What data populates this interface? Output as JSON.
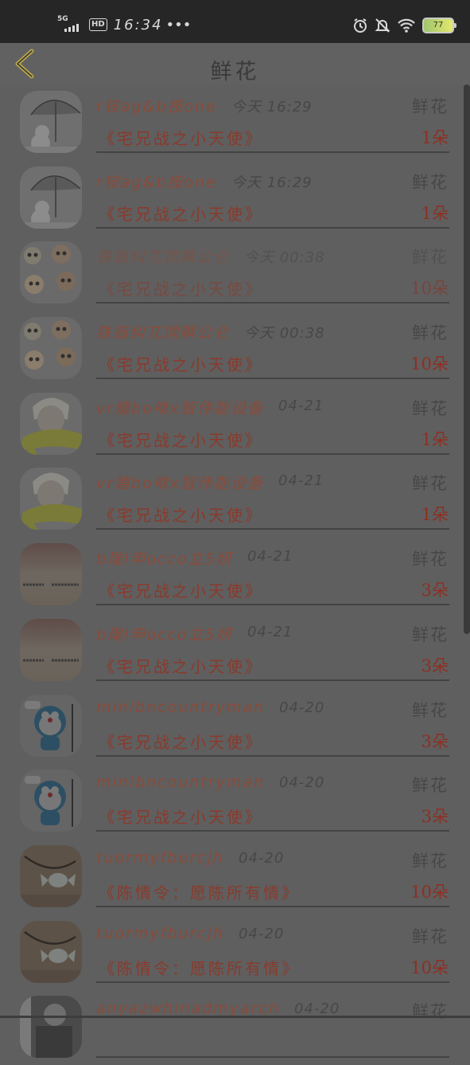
{
  "status_bar": {
    "network": "5G",
    "hd": "HD",
    "time": "16:34",
    "more": "•••",
    "battery": "77"
  },
  "header": {
    "title": "鲜花"
  },
  "items": [
    {
      "name": "r铵ag&b按one",
      "time": "今天 16:29",
      "gift": "鲜花",
      "title": "《宅兄战之小天使》",
      "qty": "1朵",
      "avatar": "umbrella-snowman"
    },
    {
      "name": "r铵ag&b按one",
      "time": "今天 16:29",
      "gift": "鲜花",
      "title": "《宅兄战之小天使》",
      "qty": "1朵",
      "avatar": "umbrella-snowman"
    },
    {
      "name": "铁扇纠兀饲瞬公仑",
      "time": "今天 00:38",
      "gift": "鲜花",
      "title": "《宅兄战之小天使》",
      "qty": "10朵",
      "avatar": "skulls"
    },
    {
      "name": "铁扇纠兀饲瞬公仑",
      "time": "今天 00:38",
      "gift": "鲜花",
      "title": "《宅兄战之小天使》",
      "qty": "10朵",
      "avatar": "skulls"
    },
    {
      "name": "vr嬉bo咻x智伟能设备",
      "time": "04-21",
      "gift": "鲜花",
      "title": "《宅兄战之小天使》",
      "qty": "1朵",
      "avatar": "anime-scarf"
    },
    {
      "name": "vr嬉bo咻x智伟能设备",
      "time": "04-21",
      "gift": "鲜花",
      "title": "《宅兄战之小天使》",
      "qty": "1朵",
      "avatar": "anime-scarf"
    },
    {
      "name": "b瑞l申occo立5妍",
      "time": "04-21",
      "gift": "鲜花",
      "title": "《宅兄战之小天使》",
      "qty": "3朵",
      "avatar": "paper-text"
    },
    {
      "name": "b瑞l申occo立5妍",
      "time": "04-21",
      "gift": "鲜花",
      "title": "《宅兄战之小天使》",
      "qty": "3朵",
      "avatar": "paper-text"
    },
    {
      "name": "minibncountryman",
      "time": "04-20",
      "gift": "鲜花",
      "title": "《宅兄战之小天使》",
      "qty": "3朵",
      "avatar": "doraemon"
    },
    {
      "name": "minibncountryman",
      "time": "04-20",
      "gift": "鲜花",
      "title": "《宅兄战之小天使》",
      "qty": "3朵",
      "avatar": "doraemon"
    },
    {
      "name": "tuormyfburcjh",
      "time": "04-20",
      "gift": "鲜花",
      "title": "《陈情令：愿陈所有情》",
      "qty": "10朵",
      "avatar": "candy-necklace"
    },
    {
      "name": "tuormyfburcjh",
      "time": "04-20",
      "gift": "鲜花",
      "title": "《陈情令：愿陈所有情》",
      "qty": "10朵",
      "avatar": "candy-necklace"
    },
    {
      "name": "anyazwhinadmyarch",
      "time": "04-20",
      "gift": "鲜花",
      "title": "",
      "qty": "",
      "avatar": "bw-photo"
    }
  ]
}
